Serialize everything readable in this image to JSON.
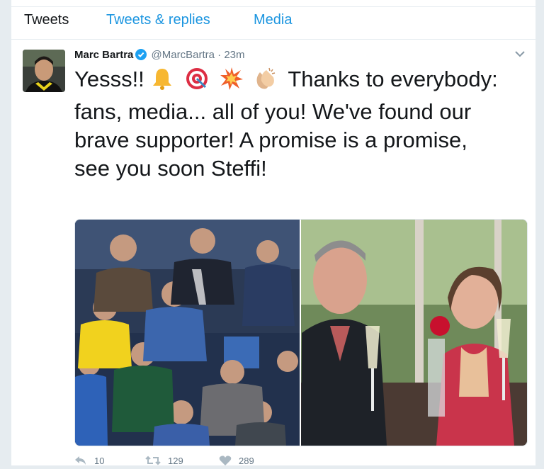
{
  "tabs": {
    "tweets": "Tweets",
    "replies": "Tweets & replies",
    "media": "Media"
  },
  "tweet": {
    "name": "Marc Bartra",
    "handle": "@MarcBartra",
    "dot": "·",
    "time": "23m",
    "text_start": "Yesss!!",
    "emojis": [
      "bell-emoji",
      "direct-hit-emoji",
      "collision-emoji",
      "clapping-hands-emoji"
    ],
    "text_rest": "Thanks to everybody: fans, media... all of you! We've found our brave supporter! A promise is a promise, see you soon Steffi!",
    "actions": {
      "reply_count": "10",
      "retweet_count": "129",
      "like_count": "289"
    }
  },
  "colors": {
    "accent": "#1b95e0",
    "text": "#14171a",
    "muted": "#657786",
    "border": "#e6ecf0"
  },
  "icons": {
    "verified": "verified-badge-icon",
    "caret": "chevron-down-icon",
    "reply": "reply-icon",
    "retweet": "retweet-icon",
    "like": "heart-icon"
  }
}
